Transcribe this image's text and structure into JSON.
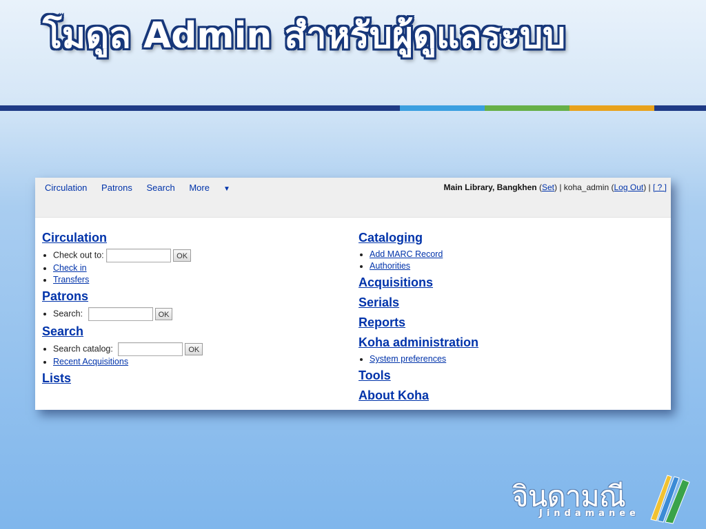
{
  "slide": {
    "title": "โมดูล Admin สำหรับผู้ดูแลระบบ",
    "accent_colors": [
      "#1f3b86",
      "#3a9fe0",
      "#66b048",
      "#e8a21c"
    ]
  },
  "koha": {
    "nav": {
      "items": [
        "Circulation",
        "Patrons",
        "Search",
        "More"
      ]
    },
    "userbar": {
      "branch": "Main Library, Bangkhen",
      "set_link": "Set",
      "user": "koha_admin",
      "logout_link": "Log Out",
      "help_link": "[ ? ]"
    },
    "left": {
      "circulation": {
        "heading": "Circulation",
        "checkout_label": "Check out to:",
        "checkout_value": "",
        "ok": "OK",
        "links": [
          "Check in",
          "Transfers"
        ]
      },
      "patrons": {
        "heading": "Patrons",
        "search_label": "Search:",
        "search_value": "",
        "ok": "OK"
      },
      "search": {
        "heading": "Search",
        "catalog_label": "Search catalog:",
        "catalog_value": "",
        "ok": "OK",
        "links": [
          "Recent Acquisitions"
        ]
      },
      "lists": {
        "heading": "Lists"
      }
    },
    "right": {
      "cataloging": {
        "heading": "Cataloging",
        "links": [
          "Add MARC Record",
          "Authorities"
        ]
      },
      "acquisitions": {
        "heading": "Acquisitions"
      },
      "serials": {
        "heading": "Serials"
      },
      "reports": {
        "heading": "Reports"
      },
      "administration": {
        "heading": "Koha administration",
        "links": [
          "System preferences"
        ]
      },
      "tools": {
        "heading": "Tools"
      },
      "about": {
        "heading": "About Koha"
      }
    }
  },
  "logo": {
    "thai": "จินดามณี",
    "latin": "Jindamanee"
  }
}
